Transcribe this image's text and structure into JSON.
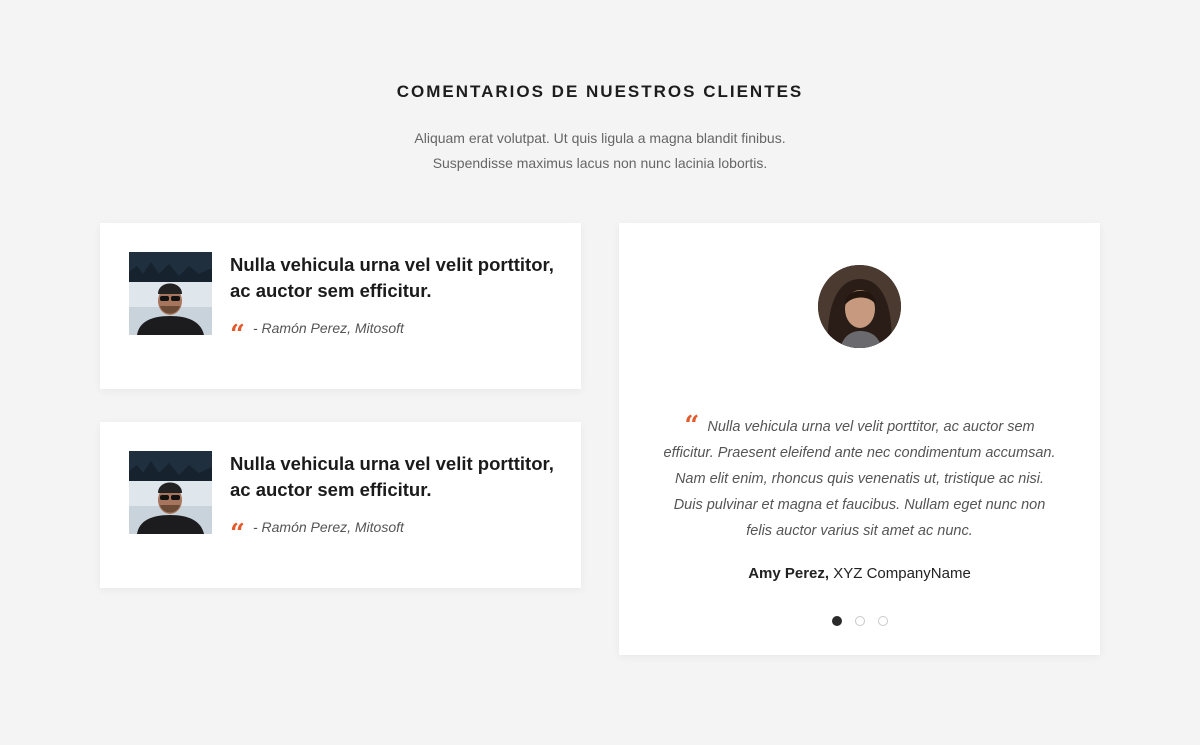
{
  "header": {
    "title": "COMENTARIOS DE NUESTROS CLIENTES",
    "subtitle_line1": "Aliquam erat volutpat. Ut quis ligula a magna blandit finibus.",
    "subtitle_line2": "Suspendisse maximus lacus non nunc lacinia lobortis."
  },
  "small_testimonials": [
    {
      "quote": "Nulla vehicula urna vel velit porttitor, ac auctor sem efficitur.",
      "quote_icon": "“",
      "author": "- Ramón Perez, Mitosoft"
    },
    {
      "quote": "Nulla vehicula urna vel velit porttitor, ac auctor sem efficitur.",
      "quote_icon": "“",
      "author": "- Ramón Perez, Mitosoft"
    }
  ],
  "featured_testimonial": {
    "quote_icon": "“",
    "text": "Nulla vehicula urna vel velit porttitor, ac auctor sem efficitur. Praesent eleifend ante nec condimentum accumsan. Nam elit enim, rhoncus quis venenatis ut, tristique ac nisi. Duis pulvinar et magna et faucibus. Nullam eget nunc non felis auctor varius sit amet ac nunc.",
    "author_name": "Amy Perez,",
    "company": "XYZ CompanyName"
  },
  "carousel": {
    "active_index": 0,
    "count": 3
  },
  "colors": {
    "accent": "#e35a2c",
    "background": "#f4f4f4",
    "card": "#ffffff"
  }
}
